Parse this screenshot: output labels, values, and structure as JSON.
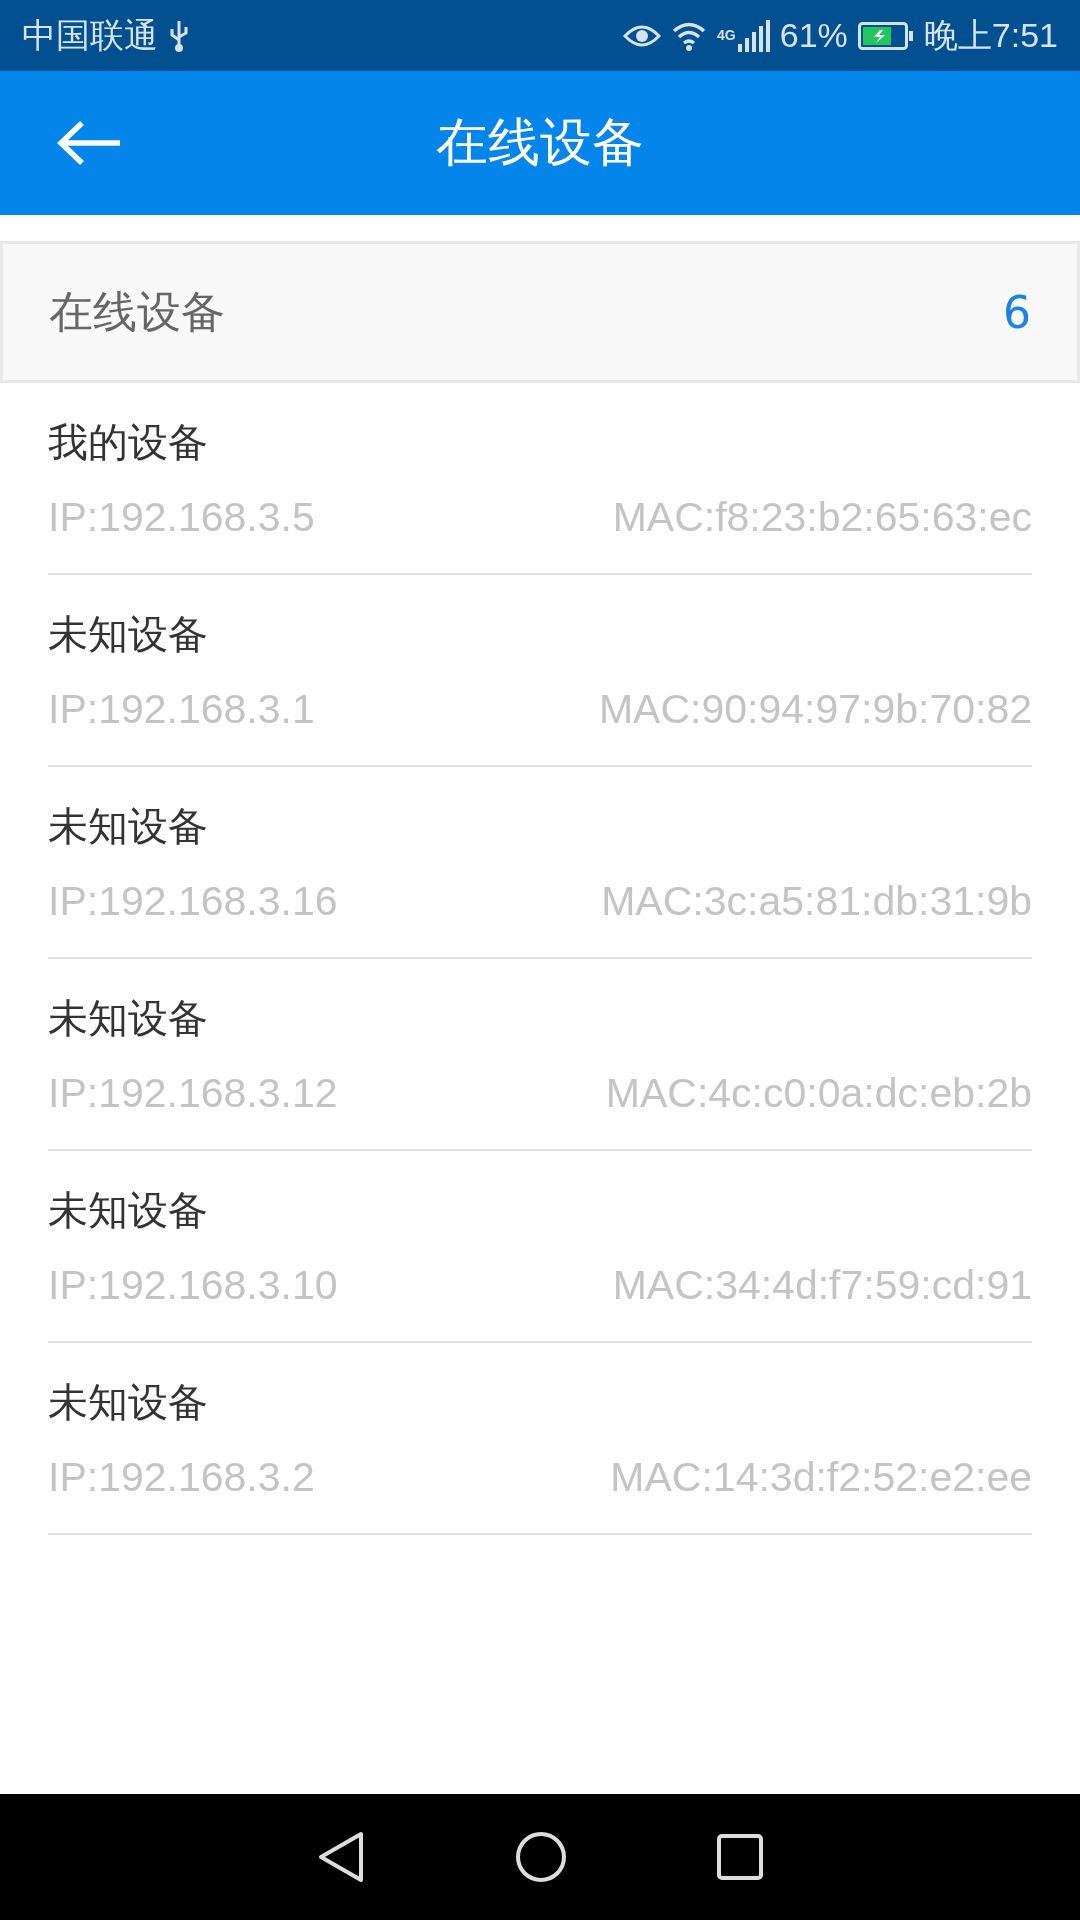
{
  "status_bar": {
    "carrier": "中国联通",
    "network_type": "4G",
    "battery": "61%",
    "time": "晚上7:51"
  },
  "app_bar": {
    "title": "在线设备"
  },
  "summary": {
    "label": "在线设备",
    "count": "6"
  },
  "devices": [
    {
      "name": "我的设备",
      "ip": "IP:192.168.3.5",
      "mac": "MAC:f8:23:b2:65:63:ec"
    },
    {
      "name": "未知设备",
      "ip": "IP:192.168.3.1",
      "mac": "MAC:90:94:97:9b:70:82"
    },
    {
      "name": "未知设备",
      "ip": "IP:192.168.3.16",
      "mac": "MAC:3c:a5:81:db:31:9b"
    },
    {
      "name": "未知设备",
      "ip": "IP:192.168.3.12",
      "mac": "MAC:4c:c0:0a:dc:eb:2b"
    },
    {
      "name": "未知设备",
      "ip": "IP:192.168.3.10",
      "mac": "MAC:34:4d:f7:59:cd:91"
    },
    {
      "name": "未知设备",
      "ip": "IP:192.168.3.2",
      "mac": "MAC:14:3d:f2:52:e2:ee"
    }
  ]
}
